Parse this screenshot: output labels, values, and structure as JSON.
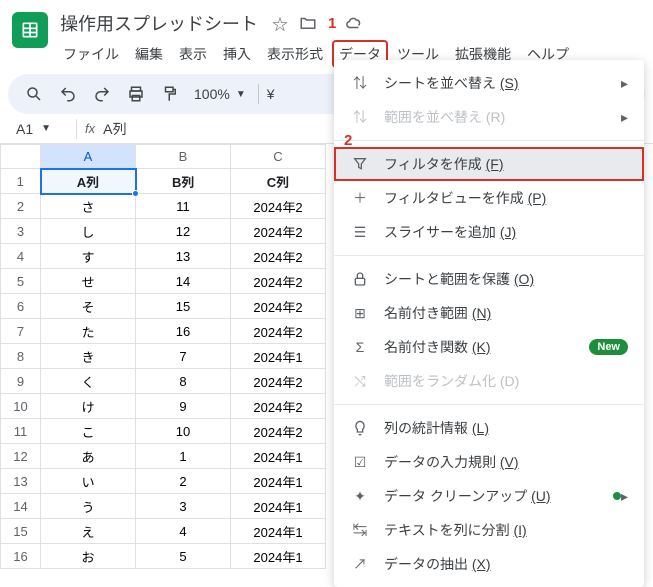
{
  "doc": {
    "title": "操作用スプレッドシート"
  },
  "annotations": {
    "one": "1",
    "two": "2"
  },
  "menubar": [
    "ファイル",
    "編集",
    "表示",
    "挿入",
    "表示形式",
    "データ",
    "ツール",
    "拡張機能",
    "ヘルプ"
  ],
  "toolbar": {
    "zoom": "100%",
    "currency": "¥"
  },
  "formula": {
    "cell_ref": "A1",
    "content": "A列"
  },
  "columns": [
    "A",
    "B",
    "C"
  ],
  "headers": [
    "A列",
    "B列",
    "C列"
  ],
  "rows": [
    {
      "n": 1,
      "a": "A列",
      "b": "B列",
      "c": "C列"
    },
    {
      "n": 2,
      "a": "さ",
      "b": "11",
      "c": "2024年2"
    },
    {
      "n": 3,
      "a": "し",
      "b": "12",
      "c": "2024年2"
    },
    {
      "n": 4,
      "a": "す",
      "b": "13",
      "c": "2024年2"
    },
    {
      "n": 5,
      "a": "せ",
      "b": "14",
      "c": "2024年2"
    },
    {
      "n": 6,
      "a": "そ",
      "b": "15",
      "c": "2024年2"
    },
    {
      "n": 7,
      "a": "た",
      "b": "16",
      "c": "2024年2"
    },
    {
      "n": 8,
      "a": "き",
      "b": "7",
      "c": "2024年1"
    },
    {
      "n": 9,
      "a": "く",
      "b": "8",
      "c": "2024年2"
    },
    {
      "n": 10,
      "a": "け",
      "b": "9",
      "c": "2024年2"
    },
    {
      "n": 11,
      "a": "こ",
      "b": "10",
      "c": "2024年2"
    },
    {
      "n": 12,
      "a": "あ",
      "b": "1",
      "c": "2024年1"
    },
    {
      "n": 13,
      "a": "い",
      "b": "2",
      "c": "2024年1"
    },
    {
      "n": 14,
      "a": "う",
      "b": "3",
      "c": "2024年1"
    },
    {
      "n": 15,
      "a": "え",
      "b": "4",
      "c": "2024年1"
    },
    {
      "n": 16,
      "a": "お",
      "b": "5",
      "c": "2024年1"
    }
  ],
  "dropdown": {
    "sort_sheet": {
      "label": "シートを並べ替え",
      "shortcut": "(S)"
    },
    "sort_range": {
      "label": "範囲を並べ替え",
      "shortcut": "(R)"
    },
    "create_filter": {
      "label": "フィルタを作成",
      "shortcut": "(F)"
    },
    "create_filter_view": {
      "label": "フィルタビューを作成",
      "shortcut": "(P)"
    },
    "add_slicer": {
      "label": "スライサーを追加",
      "shortcut": "(J)"
    },
    "protect": {
      "label": "シートと範囲を保護",
      "shortcut": "(O)"
    },
    "named_range": {
      "label": "名前付き範囲",
      "shortcut": "(N)"
    },
    "named_function": {
      "label": "名前付き関数",
      "shortcut": "(K)",
      "badge": "New"
    },
    "randomize": {
      "label": "範囲をランダム化",
      "shortcut": "(D)"
    },
    "column_stats": {
      "label": "列の統計情報",
      "shortcut": "(L)"
    },
    "validation": {
      "label": "データの入力規則",
      "shortcut": "(V)"
    },
    "cleanup": {
      "label": "データ クリーンアップ",
      "shortcut": "(U)"
    },
    "split": {
      "label": "テキストを列に分割",
      "shortcut": "(I)"
    },
    "extract": {
      "label": "データの抽出",
      "shortcut": "(X)"
    }
  }
}
